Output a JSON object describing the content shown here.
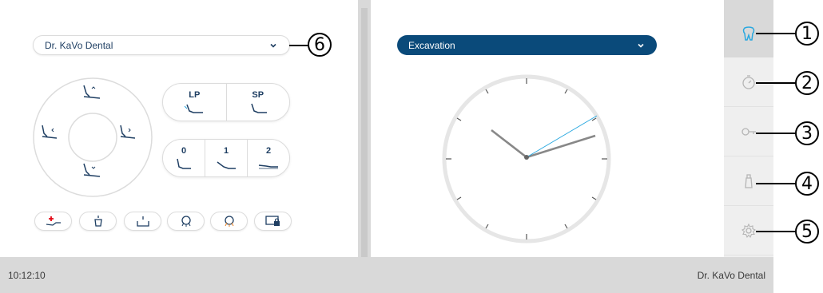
{
  "user_select": {
    "value": "Dr. KaVo Dental"
  },
  "program_select": {
    "value": "Excavation"
  },
  "lpsp_buttons": [
    {
      "label": "LP"
    },
    {
      "label": "SP"
    }
  ],
  "memory_buttons": [
    {
      "label": "0"
    },
    {
      "label": "1"
    },
    {
      "label": "2"
    }
  ],
  "status_bar": {
    "time": "10:12:10",
    "user": "Dr. KaVo Dental"
  },
  "callouts": [
    "1",
    "2",
    "3",
    "4",
    "5",
    "6"
  ],
  "side_tabs": [
    "tooth-icon",
    "timer-icon",
    "key-icon",
    "spray-bottle-icon",
    "settings-gear-icon"
  ],
  "colors": {
    "primary": "#0a4a7a",
    "accent": "#29a8e0",
    "alert": "#e30613",
    "panel_bg": "#d9d9d9"
  }
}
